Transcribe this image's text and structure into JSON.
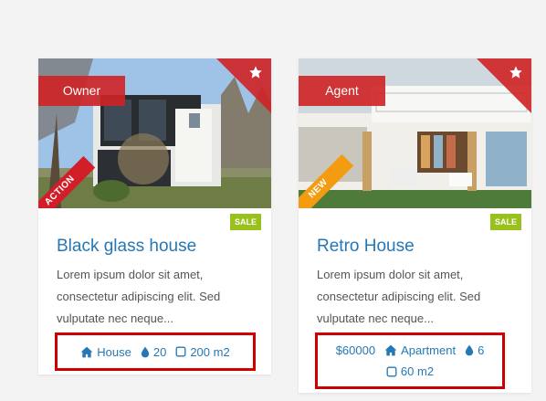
{
  "colors": {
    "accent": "#2578b5",
    "label": "#ce2225",
    "sale": "#98c11e",
    "new": "#f39c12",
    "highlight": "#cc0000"
  },
  "cards": [
    {
      "role": "Owner",
      "corner_ribbon": "ACTION",
      "badge": "SALE",
      "title": "Black glass house",
      "description": "Lorem ipsum dolor sit amet, consectetur adipiscing elit. Sed vulputate nec neque...",
      "meta": {
        "type": "House",
        "baths": "20",
        "area": "200 m2"
      },
      "icons": {
        "favorite": "star-icon",
        "type": "home-icon",
        "baths": "drop-icon",
        "area": "square-icon"
      }
    },
    {
      "role": "Agent",
      "corner_ribbon": "NEW",
      "badge": "SALE",
      "title": "Retro House",
      "description": "Lorem ipsum dolor sit amet, consectetur adipiscing elit. Sed vulputate nec neque...",
      "meta": {
        "price": "$60000",
        "type": "Apartment",
        "baths": "6",
        "area": "60 m2"
      },
      "icons": {
        "favorite": "star-icon",
        "type": "home-icon",
        "baths": "drop-icon",
        "area": "square-icon"
      }
    }
  ]
}
